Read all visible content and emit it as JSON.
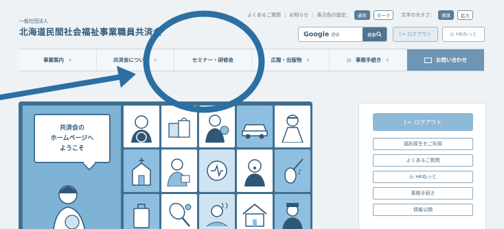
{
  "header": {
    "org_type": "一般社団法人",
    "org_name": "北海道民間社会福祉事業職員共済会"
  },
  "utility": {
    "faq": "よくあるご質問",
    "news": "お知らせ",
    "display_color_label": "表示色の設定：",
    "color_normal": "通常",
    "color_dark": "ダーク",
    "font_size_label": "文字の大きさ：",
    "size_standard": "標準",
    "size_large": "拡大"
  },
  "search": {
    "brand": "Google",
    "provided": "提供",
    "button": "検索"
  },
  "top_buttons": {
    "logout": "ログアウト",
    "hknet": "HKねっと"
  },
  "nav": [
    {
      "label": "事業案内"
    },
    {
      "label": "共済会について"
    },
    {
      "label": "セミナー・研修会"
    },
    {
      "label": "広報・出版物"
    },
    {
      "label": "事務手続き"
    },
    {
      "label": "お問い合わせ"
    }
  ],
  "hero": {
    "welcome_line1": "共済会の",
    "welcome_line2": "ホームページへ",
    "welcome_line3": "ようこそ"
  },
  "sidebar": {
    "logout": "ログアウト",
    "links": [
      {
        "label": "福利厚生をご利用"
      },
      {
        "label": "よくあるご質問"
      },
      {
        "label": "HKねっと"
      },
      {
        "label": "事務手続き"
      },
      {
        "label": "情報公開"
      }
    ]
  },
  "colors": {
    "accent": "#2f6f9e",
    "nav_contact": "#6e95b4",
    "hero_bg": "#3f6f93",
    "annotation": "#2c6fa2"
  }
}
